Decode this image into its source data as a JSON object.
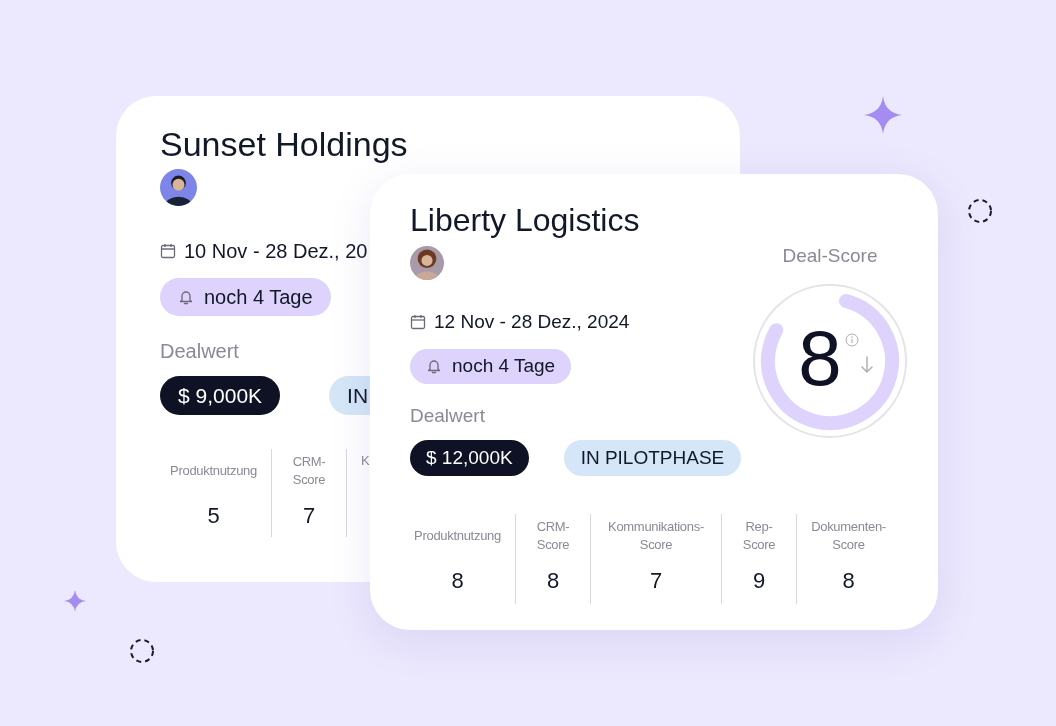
{
  "cards": [
    {
      "title": "Sunset Holdings",
      "date": "10 Nov - 28 Dez., 20",
      "reminder": "noch 4 Tage",
      "value_label": "Dealwert",
      "value": "$ 9,000K",
      "status": "IN",
      "metrics": [
        {
          "label": "Produktnutzung",
          "value": "5"
        },
        {
          "label": "CRM-Score",
          "value": "7"
        },
        {
          "label": "K"
        }
      ]
    },
    {
      "title": "Liberty Logistics",
      "date": "12 Nov - 28 Dez., 2024",
      "reminder": "noch 4 Tage",
      "value_label": "Dealwert",
      "value": "$ 12,000K",
      "status": "IN PILOTPHASE",
      "deal_score": {
        "label": "Deal-Score",
        "value": "8",
        "level": 0.79
      },
      "metrics": [
        {
          "label": "Produktnutzung",
          "value": "8"
        },
        {
          "label": "CRM-Score",
          "value": "8"
        },
        {
          "label": "Kommunikations-Score",
          "value": "7"
        },
        {
          "label": "Rep-Score",
          "value": "9"
        },
        {
          "label": "Dokumenten-Score",
          "value": "8"
        }
      ]
    }
  ]
}
